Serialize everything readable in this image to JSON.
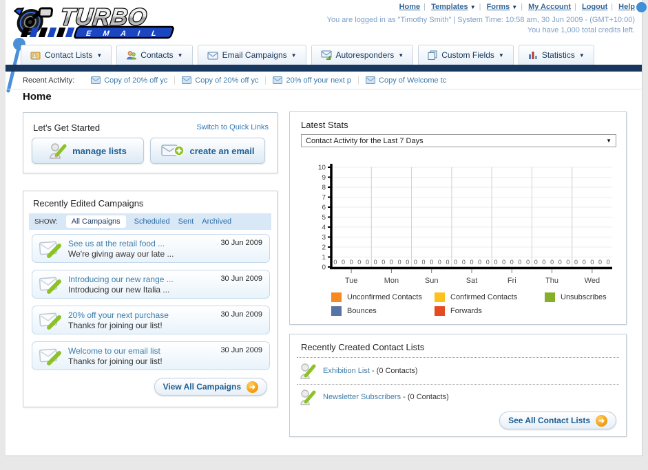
{
  "header": {
    "logo_title": "TURBO",
    "logo_subtitle": "E M A I L",
    "nav": [
      {
        "label": "Home"
      },
      {
        "label": "Templates"
      },
      {
        "label": "Forms"
      },
      {
        "label": "My Account"
      },
      {
        "label": "Logout"
      },
      {
        "label": "Help"
      }
    ],
    "login_info": "You are logged in as \"Timothy Smith\" | System Time: 10:58 am, 30 Jun 2009 - (GMT+10:00)",
    "credits_info": "You have 1,000 total credits left."
  },
  "tabs": [
    {
      "label": "Contact Lists"
    },
    {
      "label": "Contacts"
    },
    {
      "label": "Email Campaigns"
    },
    {
      "label": "Autoresponders"
    },
    {
      "label": "Custom Fields"
    },
    {
      "label": "Statistics"
    }
  ],
  "recent_activity": {
    "label": "Recent Activity:",
    "items": [
      {
        "text": "Copy of 20% off yc"
      },
      {
        "text": "Copy of 20% off yc"
      },
      {
        "text": "20% off your next p"
      },
      {
        "text": "Copy of Welcome tc"
      }
    ]
  },
  "page_title": "Home",
  "get_started": {
    "title": "Let's Get Started",
    "switch_link": "Switch to Quick Links",
    "manage_lists_label": "manage lists",
    "create_email_label": "create an email"
  },
  "campaigns": {
    "title": "Recently Edited Campaigns",
    "show_label": "SHOW:",
    "filters": [
      {
        "label": "All Campaigns"
      },
      {
        "label": "Scheduled"
      },
      {
        "label": "Sent"
      },
      {
        "label": "Archived"
      }
    ],
    "active_filter": "All Campaigns",
    "items": [
      {
        "title": "See us at the retail food ...",
        "subtitle": "We're giving away our late ...",
        "date": "30 Jun 2009"
      },
      {
        "title": "Introducing our new range ...",
        "subtitle": "Introducing our new Italia ...",
        "date": "30 Jun 2009"
      },
      {
        "title": "20% off your next purchase",
        "subtitle": "Thanks for joining our list!",
        "date": "30 Jun 2009"
      },
      {
        "title": "Welcome to our email list",
        "subtitle": "Thanks for joining our list!",
        "date": "30 Jun 2009"
      }
    ],
    "view_all_label": "View All Campaigns"
  },
  "latest_stats": {
    "title": "Latest Stats",
    "selected_option": "Contact Activity for the Last 7 Days"
  },
  "chart_data": {
    "type": "bar",
    "title": "Contact Activity for the Last 7 Days",
    "categories": [
      "Tue",
      "Mon",
      "Sun",
      "Sat",
      "Fri",
      "Thu",
      "Wed"
    ],
    "series": [
      {
        "name": "Unconfirmed Contacts",
        "color": "#f6891f",
        "values": [
          0,
          0,
          0,
          0,
          0,
          0,
          0
        ]
      },
      {
        "name": "Confirmed Contacts",
        "color": "#fcc21b",
        "values": [
          0,
          0,
          0,
          0,
          0,
          0,
          0
        ]
      },
      {
        "name": "Unsubscribes",
        "color": "#85af27",
        "values": [
          0,
          0,
          0,
          0,
          0,
          0,
          0
        ]
      },
      {
        "name": "Bounces",
        "color": "#5874a5",
        "values": [
          0,
          0,
          0,
          0,
          0,
          0,
          0
        ]
      },
      {
        "name": "Forwards",
        "color": "#e54a21",
        "values": [
          0,
          0,
          0,
          0,
          0,
          0,
          0
        ]
      }
    ],
    "xlabel": "",
    "ylabel": "",
    "ylim": [
      0,
      10
    ],
    "yticks": [
      0,
      1,
      2,
      3,
      4,
      5,
      6,
      7,
      8,
      9,
      10
    ],
    "grid": true,
    "legend_position": "bottom",
    "value_labels_shown": true
  },
  "contact_lists": {
    "title": "Recently Created Contact Lists",
    "items": [
      {
        "name": "Exhibition List",
        "suffix": " - (0 Contacts)"
      },
      {
        "name": "Newsletter Subscribers",
        "suffix": " - (0 Contacts)"
      }
    ],
    "see_all_label": "See All Contact Lists"
  },
  "colors": {
    "navy_bar": "#17375e",
    "link_blue": "#336699",
    "teal_link": "#3e7ca8",
    "login_text": "#7d9fc9",
    "accent_orange": "#f29a0a",
    "show_bar_bg": "#d8e8f7"
  }
}
